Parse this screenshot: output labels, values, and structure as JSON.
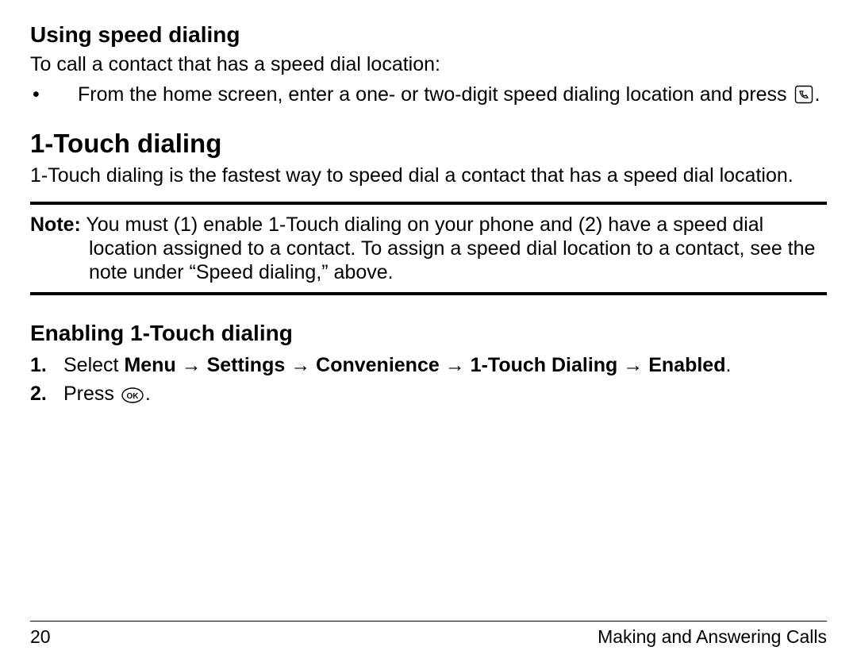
{
  "section1": {
    "heading": "Using speed dialing",
    "intro": "To call a contact that has a speed dial location:",
    "bullet": {
      "text_before": "From the home screen, enter a one- or two-digit speed dialing location and press ",
      "text_after": "."
    }
  },
  "section2": {
    "heading": "1-Touch dialing",
    "intro": "1-Touch dialing is the fastest way to speed dial a contact that has a speed dial location.",
    "note": {
      "label": "Note:",
      "text": " You must (1) enable 1-Touch dialing on your phone and (2) have a speed dial location assigned to a contact. To assign a speed dial location to a contact, see the note under “Speed dialing,” above."
    }
  },
  "section3": {
    "heading": "Enabling 1-Touch dialing",
    "steps": [
      {
        "num": "1.",
        "prefix": "Select ",
        "path": [
          "Menu",
          "Settings",
          "Convenience",
          "1-Touch Dialing",
          "Enabled"
        ],
        "suffix": "."
      },
      {
        "num": "2.",
        "prefix": "Press ",
        "suffix": "."
      }
    ]
  },
  "footer": {
    "page": "20",
    "title": "Making and Answering Calls"
  },
  "arrow": "→"
}
